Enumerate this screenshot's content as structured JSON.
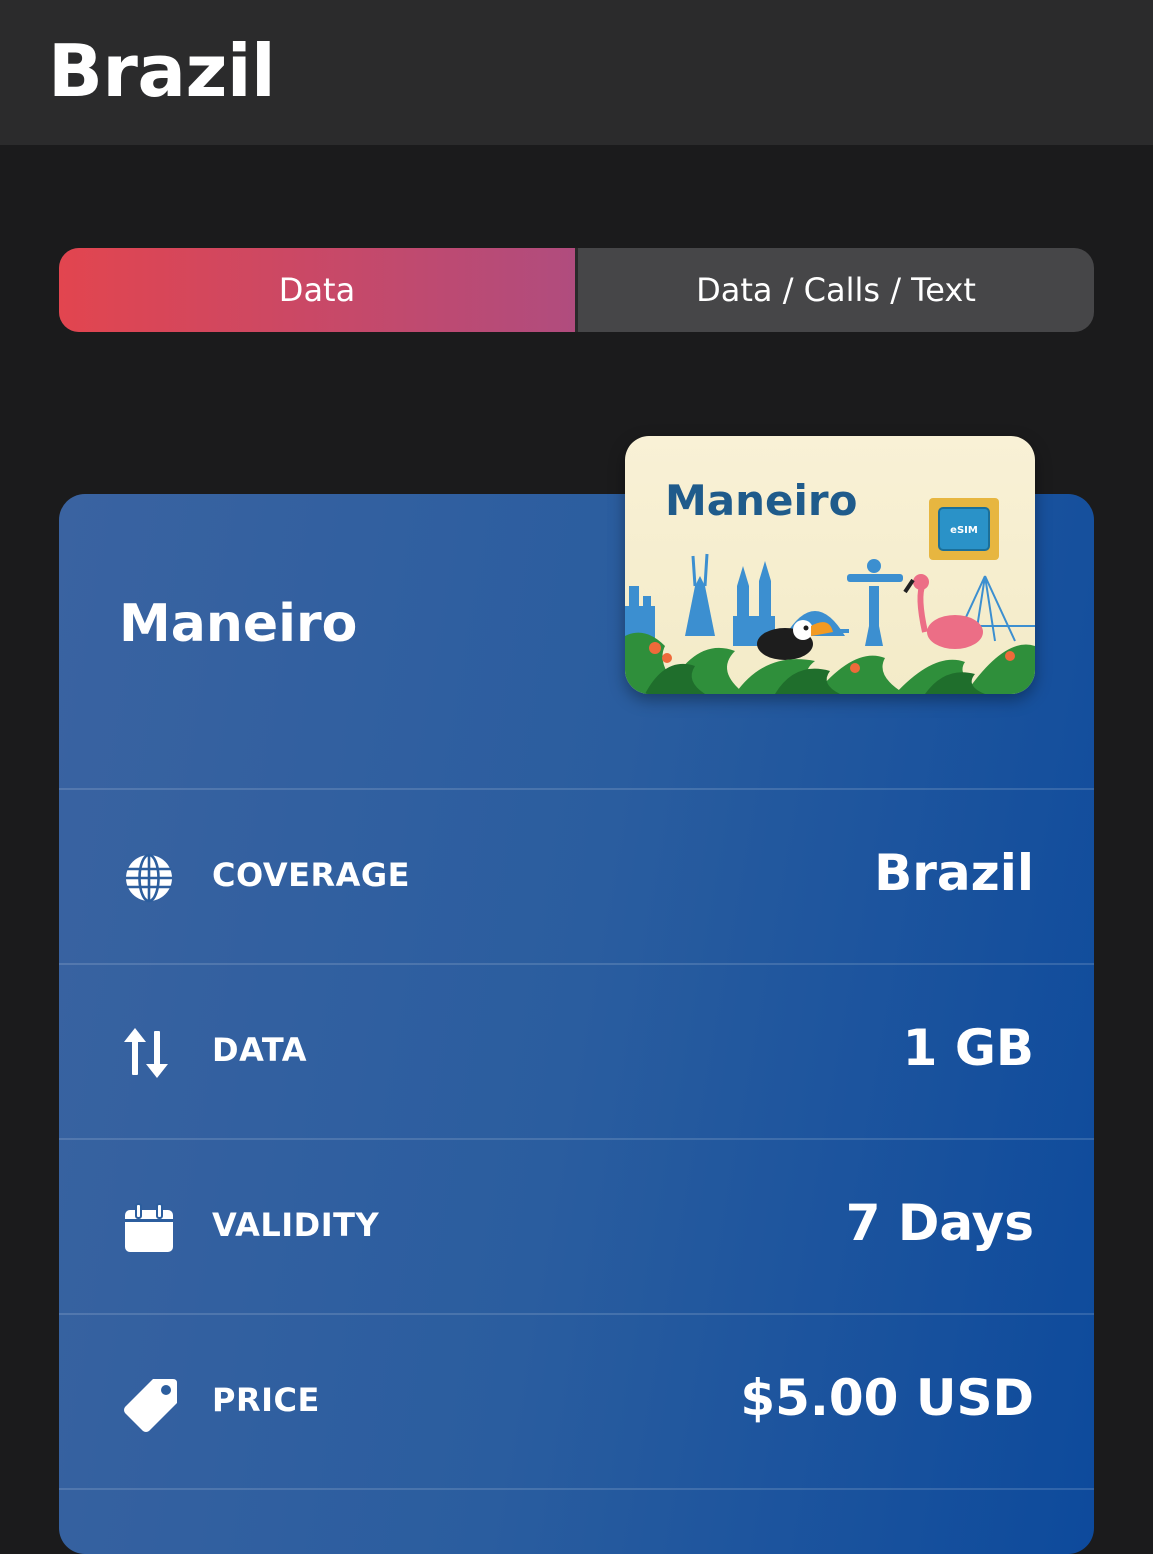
{
  "header": {
    "title": "Brazil"
  },
  "tabs": [
    {
      "label": "Data",
      "active": true
    },
    {
      "label": "Data / Calls / Text",
      "active": false
    }
  ],
  "plan": {
    "name": "Maneiro",
    "sim_card": {
      "title": "Maneiro",
      "chip_label": "eSIM"
    },
    "details": [
      {
        "icon": "globe-icon",
        "label": "COVERAGE",
        "value": "Brazil"
      },
      {
        "icon": "up-down-arrows-icon",
        "label": "DATA",
        "value": "1 GB"
      },
      {
        "icon": "calendar-icon",
        "label": "VALIDITY",
        "value": "7 Days"
      },
      {
        "icon": "price-tag-icon",
        "label": "PRICE",
        "value": "$5.00 USD"
      }
    ]
  },
  "colors": {
    "background": "#1b1b1c",
    "header": "#2b2b2c",
    "tab_active_start": "#e2454f",
    "tab_active_end": "#b04c7e",
    "tab_inactive": "#464648",
    "card": "#2a5d9f",
    "sim_title": "#1f5b8b"
  }
}
